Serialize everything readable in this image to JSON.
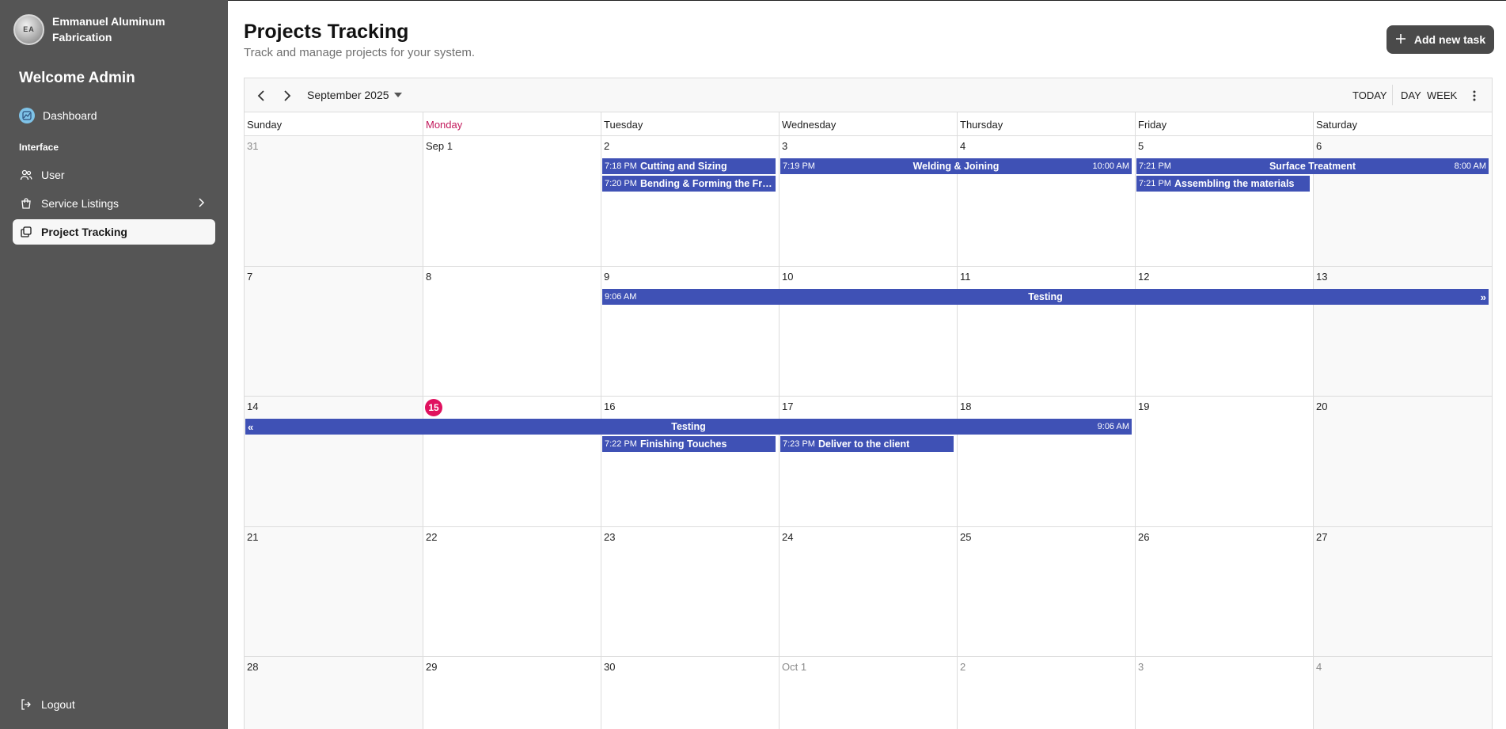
{
  "sidebar": {
    "brand_name": "Emmanuel Aluminum Fabrication",
    "logo_text": "EA",
    "welcome": "Welcome Admin",
    "dashboard_label": "Dashboard",
    "section_label": "Interface",
    "items": [
      {
        "label": "User",
        "icon": "users-icon"
      },
      {
        "label": "Service Listings",
        "icon": "shopping-bag-icon"
      },
      {
        "label": "Project Tracking",
        "icon": "copy-icon"
      }
    ],
    "logout_label": "Logout"
  },
  "header": {
    "title": "Projects Tracking",
    "subtitle": "Track and manage projects for your system.",
    "add_button": "Add new task"
  },
  "calendar": {
    "month_label": "September 2025",
    "today_button": "TODAY",
    "day_button": "DAY",
    "week_button": "WEEK",
    "days_of_week": [
      "Sunday",
      "Monday",
      "Tuesday",
      "Wednesday",
      "Thursday",
      "Friday",
      "Saturday"
    ],
    "weeks": [
      [
        "31",
        "Sep 1",
        "2",
        "3",
        "4",
        "5",
        "6"
      ],
      [
        "7",
        "8",
        "9",
        "10",
        "11",
        "12",
        "13"
      ],
      [
        "14",
        "15",
        "16",
        "17",
        "18",
        "19",
        "20"
      ],
      [
        "21",
        "22",
        "23",
        "24",
        "25",
        "26",
        "27"
      ],
      [
        "28",
        "29",
        "30",
        "Oct 1",
        "2",
        "3",
        "4"
      ]
    ],
    "events": {
      "cutting": {
        "time": "7:18 PM",
        "title": "Cutting and Sizing"
      },
      "bending": {
        "time": "7:20 PM",
        "title": "Bending & Forming the Fra..."
      },
      "welding": {
        "time": "7:19 PM",
        "title": "Welding & Joining",
        "end": "10:00 AM"
      },
      "surface": {
        "time": "7:21 PM",
        "title": "Surface Treatment",
        "end": "8:00 AM"
      },
      "assembling": {
        "time": "7:21 PM",
        "title": "Assembling the materials"
      },
      "testing1": {
        "time": "9:06 AM",
        "title": "Testing",
        "arrow": "»"
      },
      "testing2": {
        "title": "Testing",
        "end": "9:06 AM",
        "arrow": "«"
      },
      "finishing": {
        "time": "7:22 PM",
        "title": "Finishing Touches"
      },
      "deliver": {
        "time": "7:23 PM",
        "title": "Deliver to the client"
      }
    }
  },
  "colors": {
    "sidebar_bg": "#555555",
    "event_bg": "#3f51b5",
    "today_accent": "#e0115f"
  }
}
